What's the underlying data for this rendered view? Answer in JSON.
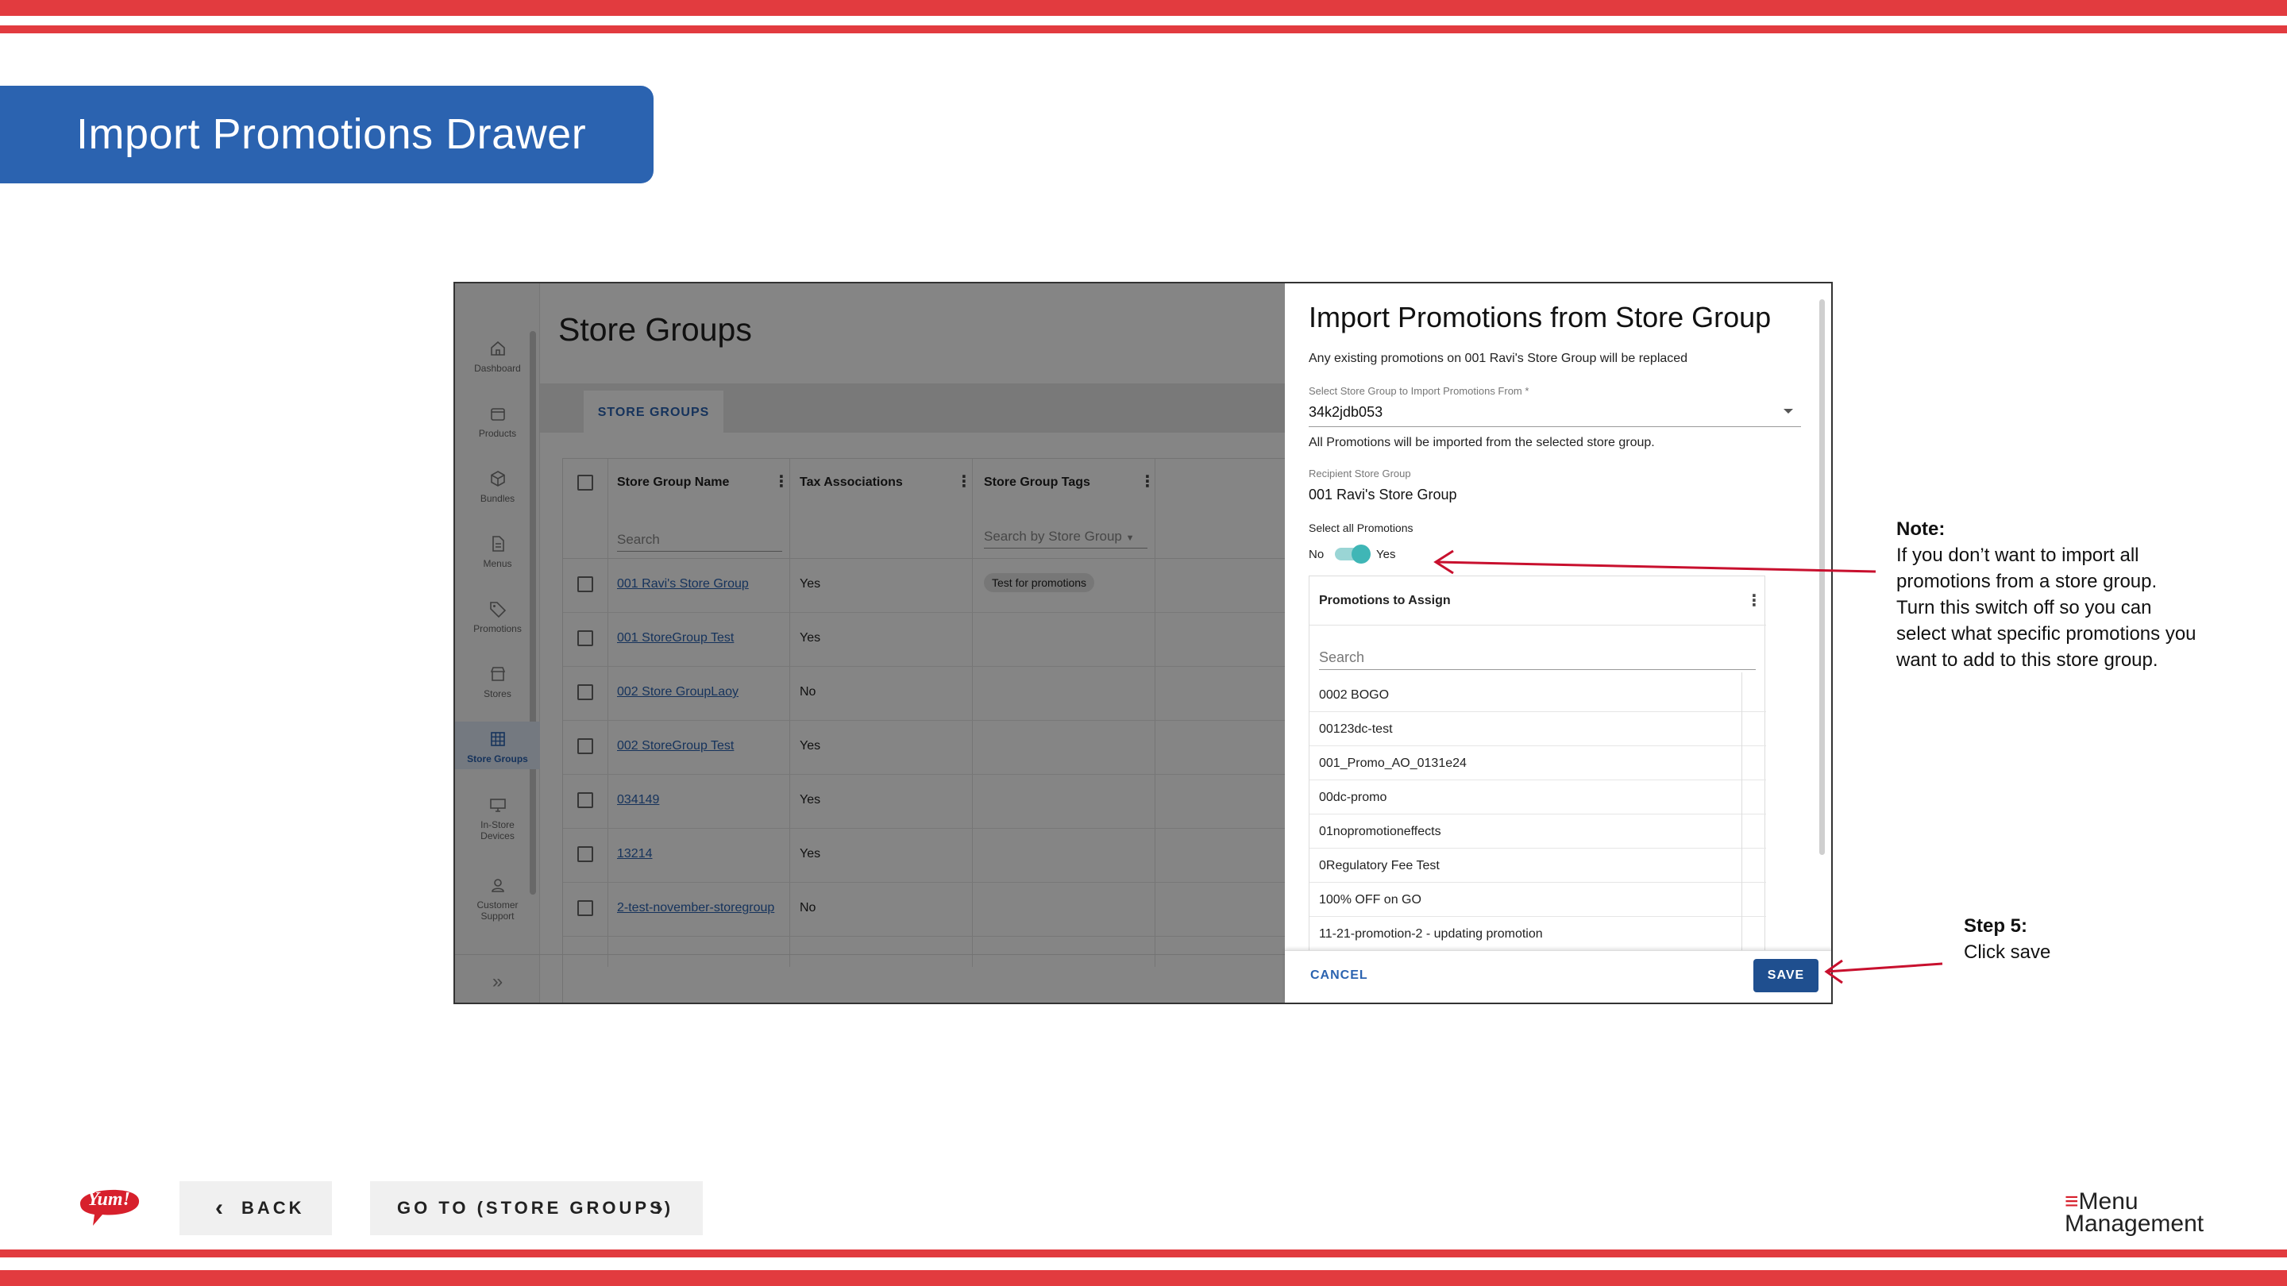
{
  "slide": {
    "title": "Import Promotions Drawer",
    "accent_red": "#e23b3f",
    "accent_blue": "#2b63b0"
  },
  "app": {
    "page_title": "Store Groups",
    "sidebar": [
      {
        "label": "Dashboard",
        "icon": "home-icon"
      },
      {
        "label": "Products",
        "icon": "package-icon"
      },
      {
        "label": "Bundles",
        "icon": "cube-icon"
      },
      {
        "label": "Menus",
        "icon": "document-icon"
      },
      {
        "label": "Promotions",
        "icon": "tag-icon"
      },
      {
        "label": "Stores",
        "icon": "store-icon"
      },
      {
        "label": "Store Groups",
        "icon": "grid-icon",
        "active": true
      },
      {
        "label": "In-Store Devices",
        "icon": "monitor-icon"
      },
      {
        "label": "Customer Support",
        "icon": "support-icon"
      }
    ],
    "tab": "STORE GROUPS",
    "table": {
      "headers": [
        "Store Group Name",
        "Tax Associations",
        "Store Group Tags"
      ],
      "search_placeholder": "Search",
      "tags_search_placeholder": "Search by Store Group",
      "rows": [
        {
          "name": "001 Ravi's Store Group",
          "tax": "Yes",
          "tag": "Test for promotions"
        },
        {
          "name": "001 StoreGroup Test",
          "tax": "Yes",
          "tag": ""
        },
        {
          "name": "002 Store GroupLaoy",
          "tax": "No",
          "tag": ""
        },
        {
          "name": "002 StoreGroup Test",
          "tax": "Yes",
          "tag": ""
        },
        {
          "name": "034149",
          "tax": "Yes",
          "tag": ""
        },
        {
          "name": "13214",
          "tax": "Yes",
          "tag": ""
        },
        {
          "name": "2-test-november-storegroup",
          "tax": "No",
          "tag": ""
        }
      ]
    }
  },
  "drawer": {
    "title": "Import Promotions from Store Group",
    "subtitle": "Any existing promotions on 001 Ravi's Store Group will be replaced",
    "select_label": "Select Store Group to Import Promotions From *",
    "select_value": "34k2jdb053",
    "select_helper": "All Promotions will be imported from the selected store group.",
    "recipient_label": "Recipient Store Group",
    "recipient_value": "001 Ravi's Store Group",
    "select_all_label": "Select all Promotions",
    "toggle_no": "No",
    "toggle_yes": "Yes",
    "toggle_on": true,
    "promotions_header": "Promotions to Assign",
    "promotions_search": "Search",
    "promotions": [
      "0002 BOGO",
      "00123dc-test",
      "001_Promo_AO_0131e24",
      "00dc-promo",
      "01nopromotioneffects",
      "0Regulatory Fee Test",
      "100% OFF on GO",
      "11-21-promotion-2 - updating promotion"
    ],
    "cancel": "CANCEL",
    "save": "SAVE"
  },
  "annotations": {
    "note_title": "Note:",
    "note_body": "If you don’t want to import all promotions from a store group. Turn this switch off so you can select what specific promotions you want to add to this store group.",
    "step_title": "Step 5:",
    "step_body": "Click save"
  },
  "footer": {
    "back": "BACK",
    "goto": "GO TO (STORE GROUPS)",
    "logo_text": "Yum!",
    "brand_line1": "Menu",
    "brand_line2": "Management"
  }
}
